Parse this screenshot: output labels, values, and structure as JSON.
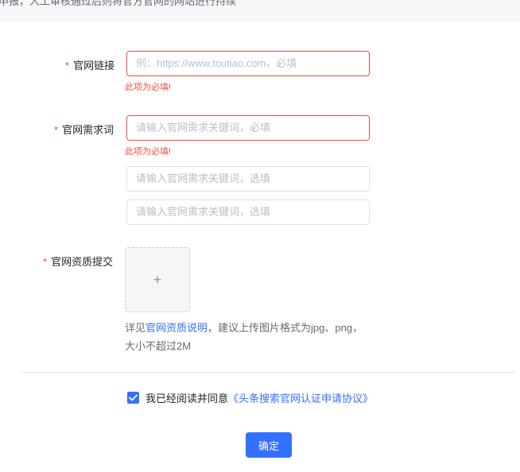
{
  "banner": {
    "text": "申报，人工审核通过后则将官方官网的网站进行持续"
  },
  "form": {
    "required_mark": "*",
    "website_link": {
      "label": "官网链接",
      "placeholder": "例：https://www.toutiao.com，必填",
      "error": "此项为必填!"
    },
    "demand_words": {
      "label": "官网需求词",
      "inputs": [
        {
          "placeholder": "请输入官网需求关键词，必填"
        },
        {
          "placeholder": "请输入官网需求关键词，选填"
        },
        {
          "placeholder": "请输入官网需求关键词，选填"
        }
      ],
      "error": "此项为必填!"
    },
    "qualification": {
      "label": "官网资质提交",
      "upload_icon": "plus-icon",
      "upload_symbol": "+",
      "hint_prefix": "详见",
      "hint_link": "官网资质说明",
      "hint_suffix": "，建议上传图片格式为jpg、png，大小不超过2M"
    }
  },
  "agreement": {
    "checked": true,
    "text": "我已经阅读并同意",
    "link": "《头条搜索官网认证申请协议》"
  },
  "confirm_button": {
    "label": "确定"
  },
  "colors": {
    "primary": "#3370ff",
    "error": "#f54a45",
    "border": "#dee0e3"
  }
}
